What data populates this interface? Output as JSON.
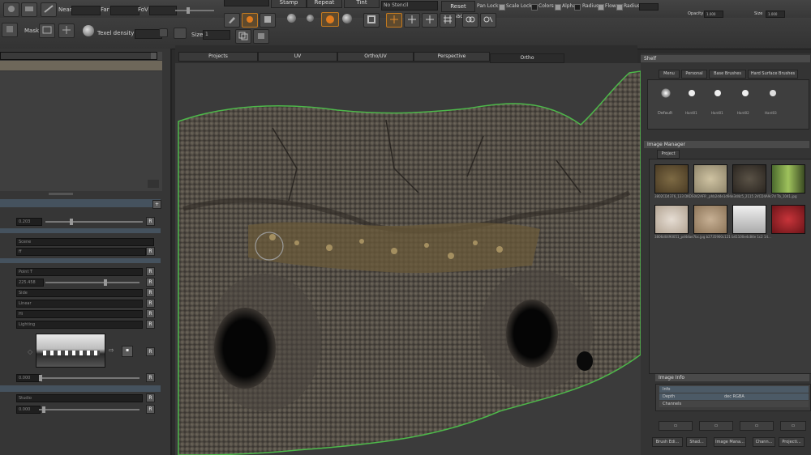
{
  "toolbar_top": {
    "near_label": "Near",
    "far_label": "Far",
    "fov_label": "FoV",
    "stamp_label": "Stamp",
    "repeat_label": "Repeat",
    "tint_label": "Tint",
    "stencil_value": "No Stencil",
    "reset_image_label": "Reset Image",
    "pan_lock_label": "Pan Lock",
    "scale_lock_label": "Scale Lock",
    "colors_label": "Colors",
    "alpha_label": "Alpha",
    "radius_label": "Radius",
    "flow_label": "Flow",
    "radius2_label": "Radius",
    "opacity_label": "Opacity",
    "opacity_value": "1.000",
    "size_label": "Size",
    "size_value": "1.000"
  },
  "toolbar_bottom": {
    "mask_label": "Mask",
    "texel_density_label": "Texel density",
    "size_label": "Size",
    "size_value": "1"
  },
  "viewport_tabs": [
    "Projects",
    "UV",
    "Ortho/UV",
    "Perspective",
    "Ortho"
  ],
  "active_tab_index": 4,
  "shelf": {
    "title": "Shelf",
    "tabs": [
      "Menu",
      "Personal",
      "Base Brushes",
      "Hard Surface Brushes"
    ],
    "brushes": [
      "Default",
      "Hard01",
      "Hard01",
      "Hard02",
      "Hard03"
    ]
  },
  "image_manager": {
    "title": "Image Manager",
    "tab": "Project",
    "file_row1": "3802CD4376_133  DKDS042AFR  _phb2d4e1d94e3d4c5_2115  2VCD4A9c7d  Tb_1041.jpg",
    "file_row2": "3806d0490051_pd4dae7bc.jpg  b2735900c121  b41100e4c84e  1c2  14...",
    "swatch_colors": [
      "#6b5633",
      "#bcb08c",
      "#3f3a30",
      "#7fa04e",
      "#d8cbbf",
      "#b79e83",
      "#d8d8d8",
      "#a82a2e"
    ]
  },
  "image_info": {
    "title": "Image Info",
    "rows": [
      {
        "key": "Info",
        "value": ""
      },
      {
        "key": "Depth",
        "value": "dec  RGBA"
      },
      {
        "key": "Channels",
        "value": ""
      }
    ]
  },
  "bottom_tabs": [
    "Brush Edi...",
    "Shad...",
    "Image Mana...",
    "Chann...",
    "Projecti..."
  ],
  "left_panel": {
    "reset_button": "R",
    "slider1_value": "0.203",
    "dropdown1": "Scene",
    "dropdown2": "ff",
    "dropdown3": "Point T",
    "dropdown3_value": "225.458",
    "dropdown4": "Side",
    "dropdown5": "Linear",
    "dropdown6": "Hi",
    "dropdown7": "Lighting",
    "slider2_value": "0.000",
    "dropdown8": "Studio",
    "slider3_value": "0.000",
    "section_label": "..."
  }
}
